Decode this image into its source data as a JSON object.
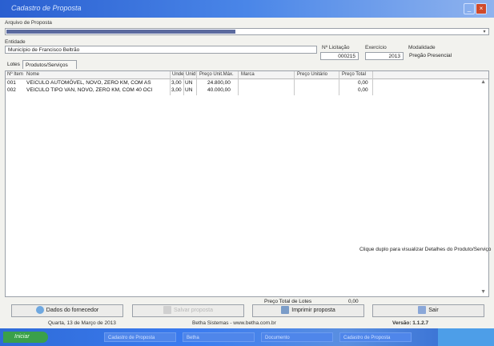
{
  "window": {
    "title": "Cadastro de Proposta"
  },
  "header": {
    "arquivo_label": "Arquivo de Proposta",
    "entidade_label": "Entidade",
    "entidade_value": "Município de Francisco Beltrão",
    "licitacao_label": "Nº Licitação",
    "licitacao_value": "000215",
    "exercicio_label": "Exercício",
    "exercicio_value": "2013",
    "modalidade_label": "Modalidade",
    "modalidade_value": "Pregão Presencial"
  },
  "tabs": [
    {
      "label": "Lotes"
    },
    {
      "label": "Produtos/Serviços"
    }
  ],
  "grid": {
    "columns": [
      "Nº Item",
      "Nome",
      "Unde",
      "Unid",
      "Preço Unit.Máx.",
      "Marca",
      "Preço Unitário",
      "Preço Total"
    ],
    "rows": [
      {
        "item": "001",
        "nome": "VEICULO AUTOMÓVEL, NOVO, ZERO KM, COM AS",
        "qtde": "3,00",
        "unid": "UN",
        "preco_max": "24.800,00",
        "marca": "",
        "preco_unit": "",
        "preco_total": "0,00"
      },
      {
        "item": "002",
        "nome": "VEICULO TIPO VAN, NOVO, ZERO KM, COM 40 OCI",
        "qtde": "3,00",
        "unid": "UN",
        "preco_max": "40.000,00",
        "marca": "",
        "preco_unit": "",
        "preco_total": "0,00"
      }
    ],
    "hint": "Clique duplo para visualizar Detalhes do Produto/Serviço"
  },
  "totals": {
    "label": "Preço Total de Lotes",
    "value": "0,00"
  },
  "buttons": {
    "fornecedor": "Dados do fornecedor",
    "disabled": "Salvar proposta",
    "imprimir": "Imprimir proposta",
    "sair": "Sair"
  },
  "status": {
    "date": "Quarta, 13 de Março de 2013",
    "company": "Betha Sistemas - www.betha.com.br",
    "version": "Versão: 1.1.2.7"
  },
  "taskbar": {
    "start": "Iniciar",
    "items": [
      "Cadastro de Proposta",
      "Betha",
      "Documento",
      "Cadastro de Proposta"
    ]
  },
  "colors": {
    "titlebar": "#2a5fd0",
    "taskbar": "#3b7cf0",
    "start": "#3aa04a"
  }
}
